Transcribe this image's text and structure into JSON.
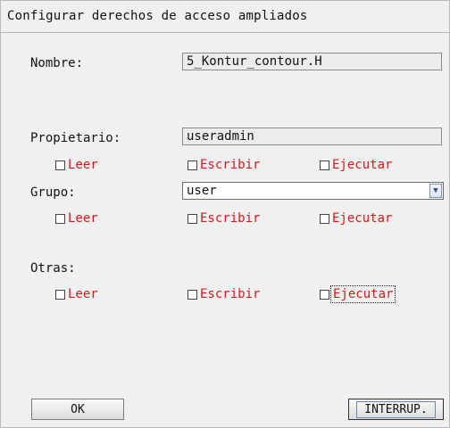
{
  "dialog": {
    "title": "Configurar derechos de acceso ampliados"
  },
  "name": {
    "label": "Nombre:",
    "value": "5_Kontur_contour.H"
  },
  "owner": {
    "label": "Propietario:",
    "value": "useradmin",
    "read": "Leer",
    "write": "Escribir",
    "execute": "Ejecutar",
    "read_checked": false,
    "write_checked": false,
    "execute_checked": false
  },
  "group": {
    "label": "Grupo:",
    "selected": "user",
    "read": "Leer",
    "write": "Escribir",
    "execute": "Ejecutar",
    "read_checked": false,
    "write_checked": false,
    "execute_checked": false
  },
  "others": {
    "label": "Otras:",
    "read": "Leer",
    "write": "Escribir",
    "execute": "Ejecutar",
    "read_checked": false,
    "write_checked": false,
    "execute_checked": false
  },
  "buttons": {
    "ok": "OK",
    "cancel": "INTERRUP."
  },
  "colors": {
    "checkbox_label": "#d21a1a",
    "background": "#f0f0f0"
  },
  "icons": {
    "dropdown": "chevron-down-icon"
  }
}
